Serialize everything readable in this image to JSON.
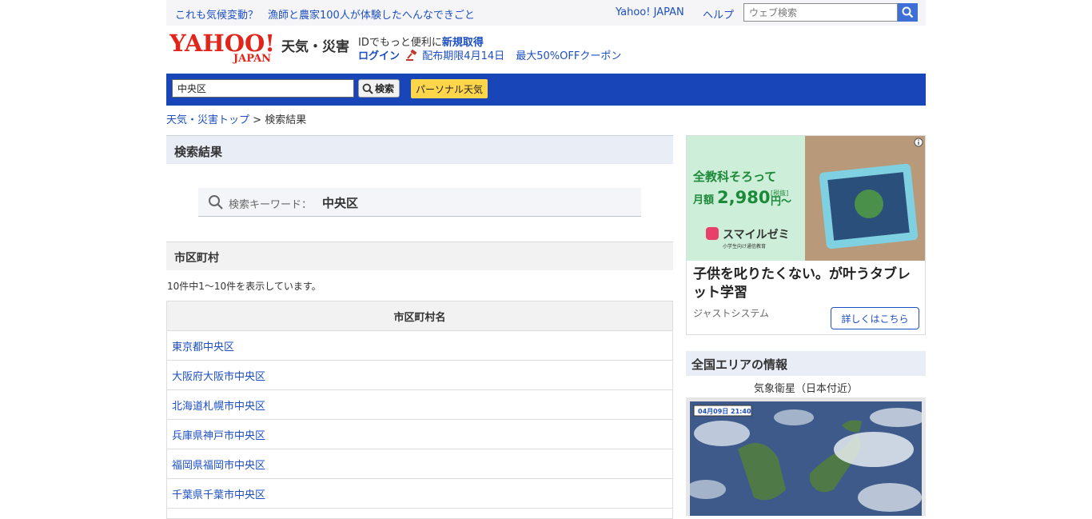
{
  "topbar": {
    "link1": "これも気候変動？",
    "link2": "漁師と農家100人が体験したへんなできごと",
    "yahoo_japan": "Yahoo! JAPAN",
    "help": "ヘルプ",
    "web_search_placeholder": "ウェブ検索"
  },
  "header": {
    "logo_text": "YAHOO!",
    "logo_sub": "JAPAN",
    "section_title": "天気・災害",
    "promo_prefix": "IDでもっと便利に",
    "promo_signup": "新規取得",
    "login": "ログイン",
    "coupon_deadline": "配布期限4月14日",
    "coupon_text": "最大50%OFFクーポン"
  },
  "searchbar": {
    "area_value": "中央区",
    "search_button": "検索",
    "personal_button": "パーソナル天気"
  },
  "breadcrumb": {
    "top": "天気・災害トップ",
    "separator": ">",
    "current": "検索結果"
  },
  "main": {
    "result_heading": "検索結果",
    "keyword_label": "検索キーワード：",
    "keyword_value": "中央区",
    "city_heading": "市区町村",
    "count_text": "10件中1〜10件を表示しています。",
    "table_header": "市区町村名",
    "rows": [
      "東京都中央区",
      "大阪府大阪市中央区",
      "北海道札幌市中央区",
      "兵庫県神戸市中央区",
      "福岡県福岡市中央区",
      "千葉県千葉市中央区"
    ]
  },
  "ad": {
    "headline1": "全教科そろって",
    "headline2_prefix": "月額",
    "price": "2,980",
    "tax": "[税抜]",
    "price_suffix": "円〜",
    "brand": "スマイルゼミ",
    "brand_sub": "小学生向け通信教育",
    "title": "子供を叱りたくない。が叶うタブレット学習",
    "sponsor": "ジャストシステム",
    "cta": "詳しくはこちら"
  },
  "sidebar": {
    "area_heading": "全国エリアの情報",
    "satellite_label": "気象衛星（日本付近）",
    "satellite_timestamp": "04月09日 21:40"
  },
  "colors": {
    "link": "#1d4fc2",
    "bluebar": "#1846b8",
    "personal_button": "#ffd54a",
    "logo_red": "#e1251b"
  }
}
